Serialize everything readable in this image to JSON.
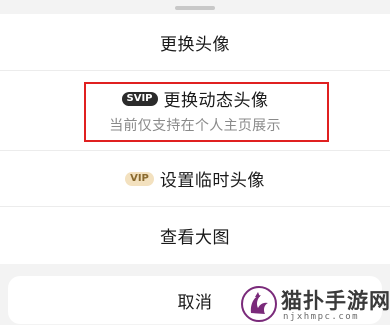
{
  "action_sheet": {
    "items": [
      {
        "label": "更换头像"
      },
      {
        "badge": "SVIP",
        "label": "更换动态头像",
        "subtitle": "当前仅支持在个人主页展示"
      },
      {
        "badge": "VIP",
        "label": "设置临时头像"
      },
      {
        "label": "查看大图"
      }
    ],
    "cancel_label": "取消"
  },
  "watermark": {
    "title": "猫扑手游网",
    "url": "njxhmpc.com"
  },
  "colors": {
    "highlight_box": "#e02020",
    "svip_badge_bg": "#2b2b2b",
    "vip_badge_bg": "#f3e1bf"
  }
}
